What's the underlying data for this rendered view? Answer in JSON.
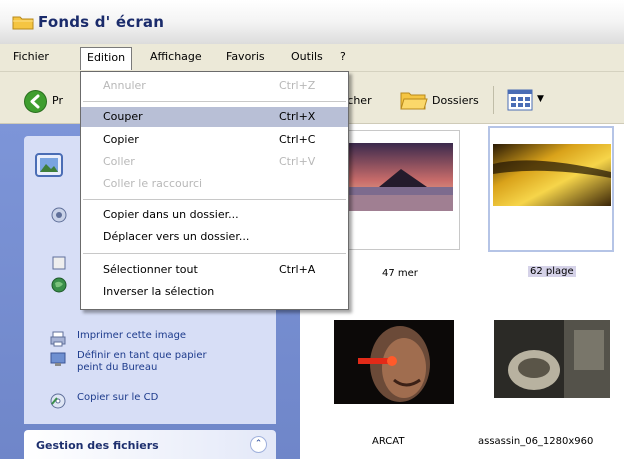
{
  "window": {
    "title": "Fonds d' écran"
  },
  "menubar": {
    "items": [
      {
        "label": "Fichier"
      },
      {
        "label": "Edition"
      },
      {
        "label": "Affichage"
      },
      {
        "label": "Favoris"
      },
      {
        "label": "Outils"
      },
      {
        "label": "?"
      }
    ]
  },
  "toolbar": {
    "back_label": "Pr",
    "search_label": "rcher",
    "folders_label": "Dossiers"
  },
  "edit_menu": {
    "items": [
      {
        "label": "Annuler",
        "shortcut": "Ctrl+Z",
        "enabled": false
      },
      {
        "label": "Couper",
        "shortcut": "Ctrl+X",
        "enabled": true,
        "highlighted": true
      },
      {
        "label": "Copier",
        "shortcut": "Ctrl+C",
        "enabled": true
      },
      {
        "label": "Coller",
        "shortcut": "Ctrl+V",
        "enabled": false
      },
      {
        "label": "Coller le raccourci",
        "shortcut": "",
        "enabled": false
      },
      {
        "label": "Copier dans un dossier...",
        "shortcut": "",
        "enabled": true
      },
      {
        "label": "Déplacer vers un dossier...",
        "shortcut": "",
        "enabled": true
      },
      {
        "label": "Sélectionner tout",
        "shortcut": "Ctrl+A",
        "enabled": true
      },
      {
        "label": "Inverser la sélection",
        "shortcut": "",
        "enabled": true
      }
    ]
  },
  "tasks": {
    "links": [
      {
        "label": "Imprimer cette image"
      },
      {
        "label": "Définir en tant que papier peint du Bureau"
      },
      {
        "label": "Copier sur le CD"
      }
    ],
    "gestion_label": "Gestion des fichiers"
  },
  "files": [
    {
      "name": "47 mer",
      "selected": false
    },
    {
      "name": "62 plage",
      "selected": true
    },
    {
      "name": "ARCAT",
      "selected": false
    },
    {
      "name": "assassin_06_1280x960",
      "selected": false
    }
  ],
  "colors": {
    "taskpane": "#7d95d8",
    "menu_highlight": "#b8bfd6",
    "title_text": "#1a2b6b"
  }
}
